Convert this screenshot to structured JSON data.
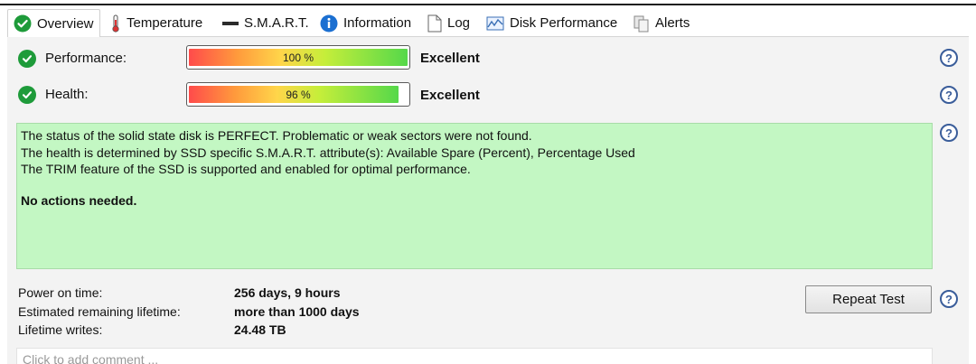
{
  "tabs": [
    {
      "label": "Overview",
      "icon": "check-circle-icon",
      "active": true
    },
    {
      "label": "Temperature",
      "icon": "thermometer-icon"
    },
    {
      "label": "S.M.A.R.T.",
      "icon": "dash-icon"
    },
    {
      "label": "Information",
      "icon": "info-icon"
    },
    {
      "label": "Log",
      "icon": "document-icon"
    },
    {
      "label": "Disk Performance",
      "icon": "chart-icon"
    },
    {
      "label": "Alerts",
      "icon": "alerts-icon"
    }
  ],
  "performance": {
    "label": "Performance:",
    "value_text": "100 %",
    "value": 100,
    "rating": "Excellent"
  },
  "health": {
    "label": "Health:",
    "value_text": "96 %",
    "value": 96,
    "rating": "Excellent"
  },
  "status": {
    "line1": "The status of the solid state disk is PERFECT. Problematic or weak sectors were not found.",
    "line2": "The health is determined by SSD specific S.M.A.R.T. attribute(s):  Available Spare (Percent), Percentage Used",
    "line3": "The TRIM feature of the SSD is supported and enabled for optimal performance.",
    "action": "No actions needed."
  },
  "info": {
    "power_on_label": "Power on time:",
    "power_on_value": "256 days, 9 hours",
    "lifetime_label": "Estimated remaining lifetime:",
    "lifetime_value": "more than 1000 days",
    "writes_label": "Lifetime writes:",
    "writes_value": "24.48 TB"
  },
  "repeat_test_label": "Repeat Test",
  "help_glyph": "?",
  "comment_placeholder": "Click to add comment ...",
  "colors": {
    "status_bg": "#c3f7c3",
    "ok_green": "#1e9b3a",
    "help_blue": "#3a5d9a"
  }
}
